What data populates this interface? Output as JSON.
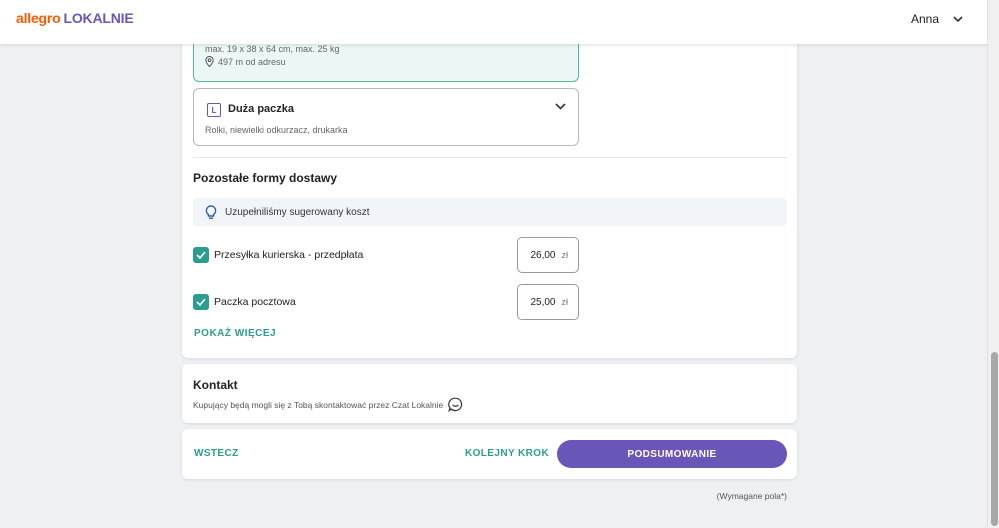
{
  "header": {
    "logo_part1": "allegro",
    "logo_part2": "LOKALNIE",
    "user_name": "Anna"
  },
  "parcel_selected": {
    "dimensions": "max. 19 x 38 x 64 cm, max. 25 kg",
    "distance": "497 m od adresu"
  },
  "parcel_large": {
    "size_letter": "L",
    "title": "Duża paczka",
    "description": "Rolki, niewielki odkurzacz, drukarka"
  },
  "other_delivery": {
    "title": "Pozostałe formy dostawy",
    "hint": "Uzupełniliśmy sugerowany koszt",
    "options": [
      {
        "label": "Przesyłka kurierska - przedpłata",
        "price": "26,00",
        "currency": "zł",
        "checked": true
      },
      {
        "label": "Paczka pocztowa",
        "price": "25,00",
        "currency": "zł",
        "checked": true
      }
    ],
    "show_more": "POKAŻ WIĘCEJ"
  },
  "contact": {
    "title": "Kontakt",
    "description": "Kupujący będą mogli się z Tobą skontaktować przez Czat Lokalnie"
  },
  "actions": {
    "back": "WSTECZ",
    "next": "KOLEJNY KROK",
    "summary": "PODSUMOWANIE"
  },
  "footer": {
    "required_note": "(Wymagane pola*)"
  },
  "colors": {
    "brand_orange": "#ff5a00",
    "brand_purple": "#6a55b8",
    "accent_teal": "#2a9d8f"
  }
}
